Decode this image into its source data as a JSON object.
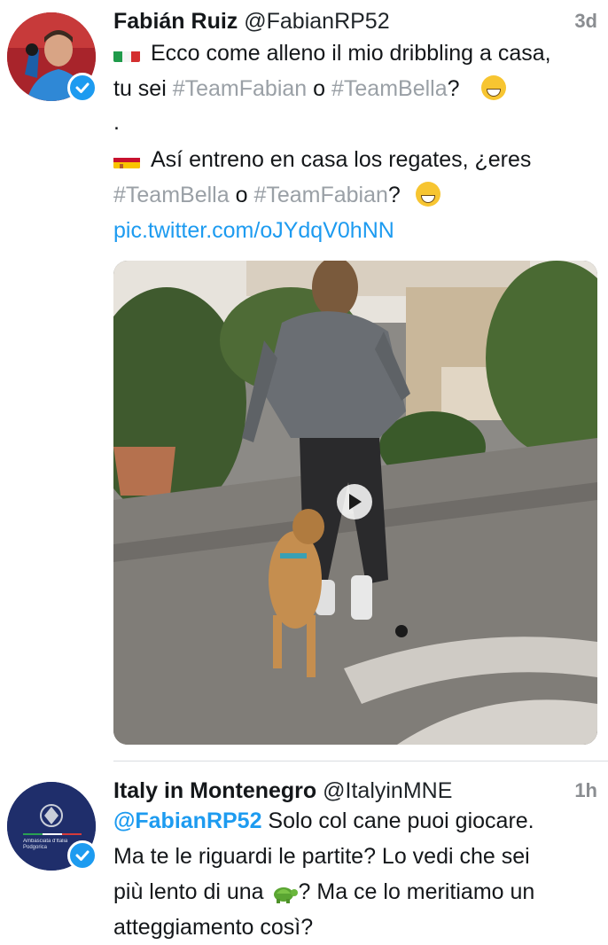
{
  "tweet1": {
    "name": "Fabián Ruiz",
    "handle": "@FabianRP52",
    "time": "3d",
    "it_text_1": "Ecco come alleno il mio dribbling a casa,",
    "it_text_2a": "tu sei ",
    "it_hashtag_1": "#TeamFabian",
    "it_text_2b": " o ",
    "it_hashtag_2": "#TeamBella",
    "it_text_2c": "?",
    "dot": ".",
    "es_text_1": "Así entreno en casa los regates, ¿eres",
    "es_hashtag_1": "#TeamBella",
    "es_text_2b": " o ",
    "es_hashtag_2": "#TeamFabian",
    "es_text_2c": "?",
    "link": "pic.twitter.com/oJYdqV0hNN",
    "icons": {
      "avatar": "avatar-fabian-ruiz",
      "verified": "verified-badge-icon",
      "flag_it": "italy-flag-icon",
      "flag_es": "spain-flag-icon",
      "emoji": "grinning-face-emoji",
      "play": "play-icon"
    }
  },
  "tweet2": {
    "name": "Italy in Montenegro",
    "handle": "@ItalyinMNE",
    "time": "1h",
    "mention": "@FabianRP52",
    "text_1": " Solo col cane puoi giocare.",
    "text_2": "Ma te le riguardi le partite? Lo vedi che sei",
    "text_3a": "più lento di una ",
    "text_3b": "? Ma ce lo meritiamo un",
    "text_4": "atteggiamento così?",
    "avatar_text": "Ambasciata d'Italia Podgorica",
    "icons": {
      "turtle": "turtle-emoji"
    }
  },
  "colors": {
    "link": "#1d9bf0",
    "hashtag": "#9aa0a6",
    "verified": "#1d9bf0"
  }
}
